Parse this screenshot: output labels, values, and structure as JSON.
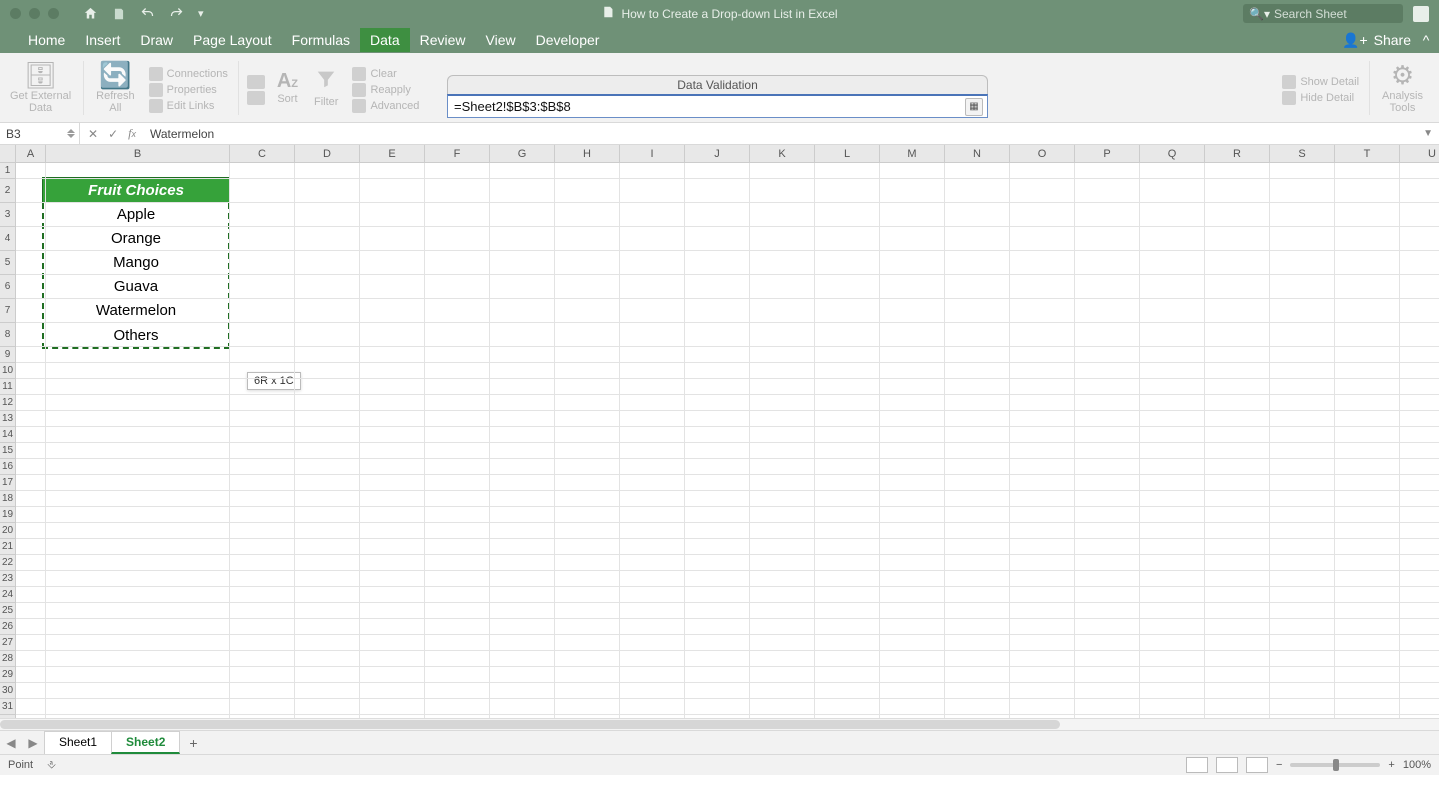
{
  "window": {
    "title": "How to Create a Drop-down List in Excel"
  },
  "search": {
    "placeholder": "Search Sheet"
  },
  "share": {
    "label": "Share"
  },
  "tabs": {
    "items": [
      "Home",
      "Insert",
      "Draw",
      "Page Layout",
      "Formulas",
      "Data",
      "Review",
      "View",
      "Developer"
    ],
    "active": "Data"
  },
  "ribbon": {
    "get_external_data": "Get External\nData",
    "refresh_all": "Refresh\nAll",
    "connections": "Connections",
    "properties": "Properties",
    "edit_links": "Edit Links",
    "sort": "Sort",
    "filter": "Filter",
    "clear": "Clear",
    "reapply": "Reapply",
    "advanced": "Advanced",
    "show_detail": "Show Detail",
    "hide_detail": "Hide Detail",
    "analysis_tools": "Analysis\nTools"
  },
  "data_validation": {
    "title": "Data Validation",
    "value": "=Sheet2!$B$3:$B$8"
  },
  "formula_bar": {
    "name_box": "B3",
    "content": "Watermelon"
  },
  "columns": [
    "A",
    "B",
    "C",
    "D",
    "E",
    "F",
    "G",
    "H",
    "I",
    "J",
    "K",
    "L",
    "M",
    "N",
    "O",
    "P",
    "Q",
    "R",
    "S",
    "T",
    "U"
  ],
  "col_widths": {
    "A": 30,
    "default": 65,
    "B": 184
  },
  "rows": 32,
  "tall_rows_from": 2,
  "tall_rows_to": 8,
  "tall_row_height": 24,
  "table": {
    "header": "Fruit Choices",
    "values": [
      "Apple",
      "Orange",
      "Mango",
      "Guava",
      "Watermelon",
      "Others"
    ]
  },
  "selection_tooltip": "6R x 1C",
  "sheets": {
    "items": [
      "Sheet1",
      "Sheet2"
    ],
    "active": "Sheet2"
  },
  "status": {
    "mode": "Point",
    "zoom": "100%"
  }
}
